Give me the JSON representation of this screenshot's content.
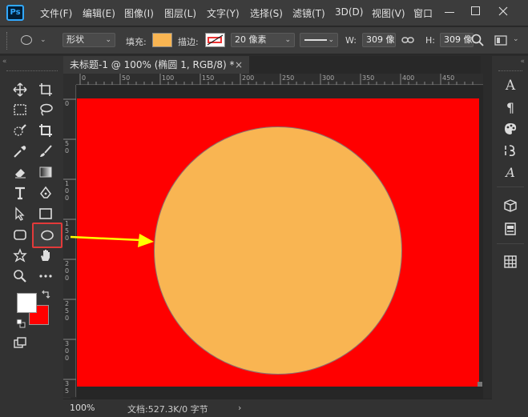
{
  "app": {
    "logo": "Ps"
  },
  "menu": [
    "文件(F)",
    "编辑(E)",
    "图像(I)",
    "图层(L)",
    "文字(Y)",
    "选择(S)",
    "滤镜(T)",
    "3D(D)",
    "视图(V)",
    "窗口"
  ],
  "options": {
    "mode": "形状",
    "fill_label": "填充:",
    "fill_color": "#f9b552",
    "stroke_label": "描边:",
    "stroke_width": "20 像素",
    "w_label": "W:",
    "w_value": "309 像",
    "h_label": "H:",
    "h_value": "309 像"
  },
  "document": {
    "tab_title": "未标题-1 @ 100% (椭圆 1, RGB/8) *",
    "close": "×",
    "canvas_color": "#ff0000",
    "shape_color": "#f9b552"
  },
  "ruler_top": [
    "0",
    "50",
    "100",
    "150",
    "200",
    "250",
    "300",
    "350",
    "400",
    "450"
  ],
  "ruler_left": [
    "0",
    "5\n0",
    "1\n0\n0",
    "1\n5\n0",
    "2\n0\n0",
    "2\n5\n0",
    "3\n0\n0",
    "3\n5"
  ],
  "colors": {
    "foreground": "#ffffff",
    "background": "#ff0000",
    "highlight": "#e23a3a",
    "arrow": "#ffff00"
  },
  "status": {
    "zoom": "100%",
    "doc_size": "文档:527.3K/0 字节",
    "arrow": "›"
  },
  "right_panel": {
    "character_glyph": "A",
    "paragraph_glyph": "¶",
    "glyph_italic": "A"
  }
}
